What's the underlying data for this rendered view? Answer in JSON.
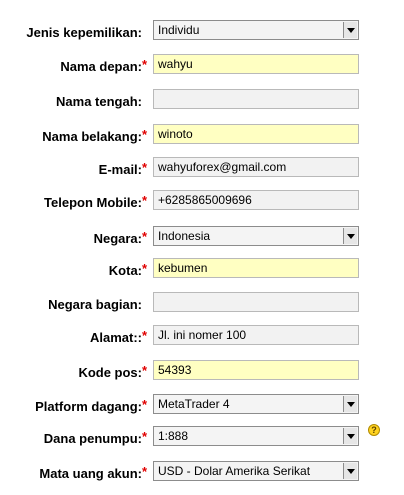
{
  "form": {
    "rows": [
      {
        "label": "Jenis kepemilikan:",
        "required": "",
        "value": "Individu",
        "kind": "select"
      },
      {
        "label": "Nama depan:",
        "required": "*",
        "value": "wahyu",
        "kind": "yellow"
      },
      {
        "label": "Nama tengah:",
        "required": "",
        "value": "",
        "kind": "text"
      },
      {
        "label": "Nama belakang:",
        "required": "*",
        "value": "winoto",
        "kind": "yellow"
      },
      {
        "label": "E-mail:",
        "required": "*",
        "value": "wahyuforex@gmail.com",
        "kind": "text"
      },
      {
        "label": "Telepon Mobile:",
        "required": "*",
        "value": "+6285865009696",
        "kind": "text"
      },
      {
        "label": "Negara:",
        "required": "*",
        "value": "Indonesia",
        "kind": "select"
      },
      {
        "label": "Kota:",
        "required": "*",
        "value": "kebumen",
        "kind": "yellow"
      },
      {
        "label": "Negara bagian:",
        "required": "",
        "value": "",
        "kind": "text"
      },
      {
        "label": "Alamat::",
        "required": "*",
        "value": "Jl. ini nomer 100",
        "kind": "text"
      },
      {
        "label": "Kode pos:",
        "required": "*",
        "value": "54393",
        "kind": "yellow"
      },
      {
        "label": "Platform dagang:",
        "required": "*",
        "value": "MetaTrader 4",
        "kind": "select"
      },
      {
        "label": "Dana penumpu:",
        "required": "*",
        "value": "1:888",
        "kind": "select",
        "help": "?"
      },
      {
        "label": "Mata uang akun:",
        "required": "*",
        "value": "USD - Dolar Amerika Serikat",
        "kind": "select"
      }
    ]
  },
  "icons": {
    "help": "help-icon",
    "dropdown": "chevron-down-icon"
  },
  "colors": {
    "required": "#e00000",
    "highlight": "#ffffc2",
    "field": "#f2f2f2"
  }
}
